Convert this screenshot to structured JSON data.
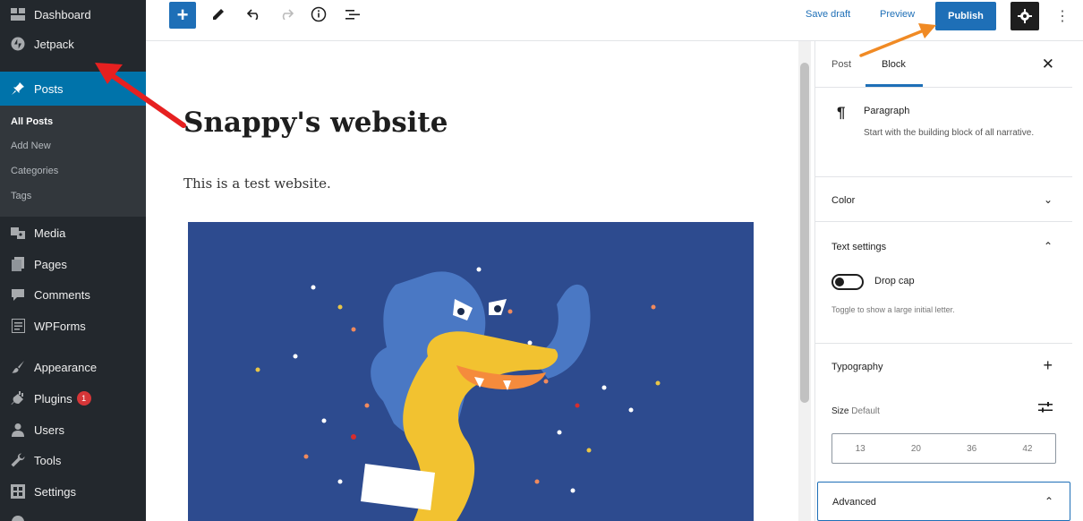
{
  "sidebar": {
    "items": [
      {
        "label": "Dashboard",
        "icon": "dashboard-icon"
      },
      {
        "label": "Jetpack",
        "icon": "jetpack-icon"
      },
      {
        "label": "Posts",
        "icon": "pin-icon",
        "active": true
      },
      {
        "label": "Media",
        "icon": "media-icon"
      },
      {
        "label": "Pages",
        "icon": "pages-icon"
      },
      {
        "label": "Comments",
        "icon": "comments-icon"
      },
      {
        "label": "WPForms",
        "icon": "wpforms-icon"
      },
      {
        "label": "Appearance",
        "icon": "appearance-icon"
      },
      {
        "label": "Plugins",
        "icon": "plugins-icon",
        "badge": "1"
      },
      {
        "label": "Users",
        "icon": "users-icon"
      },
      {
        "label": "Tools",
        "icon": "tools-icon"
      },
      {
        "label": "Settings",
        "icon": "settings-icon"
      }
    ],
    "posts_submenu": [
      "All Posts",
      "Add New",
      "Categories",
      "Tags"
    ]
  },
  "toolbar": {
    "save_draft": "Save draft",
    "preview": "Preview",
    "publish": "Publish"
  },
  "editor": {
    "title": "Snappy's website",
    "paragraph": "This is a test website."
  },
  "panel": {
    "tabs": [
      "Post",
      "Block"
    ],
    "active_tab": "Block",
    "block_name": "Paragraph",
    "block_description": "Start with the building block of all narrative.",
    "color_title": "Color",
    "text_settings_title": "Text settings",
    "drop_cap_label": "Drop cap",
    "drop_cap_help": "Toggle to show a large initial letter.",
    "typography_title": "Typography",
    "size_label": "Size",
    "size_default": "Default",
    "font_sizes": [
      "13",
      "20",
      "36",
      "42"
    ],
    "advanced_title": "Advanced"
  },
  "colors": {
    "sidebar_bg": "#23282d",
    "active_menu": "#0073aa",
    "publish_blue": "#1e6fb7",
    "image_bg": "#2d4b8f",
    "arrow_red": "#e62020",
    "arrow_orange": "#f08a24"
  }
}
